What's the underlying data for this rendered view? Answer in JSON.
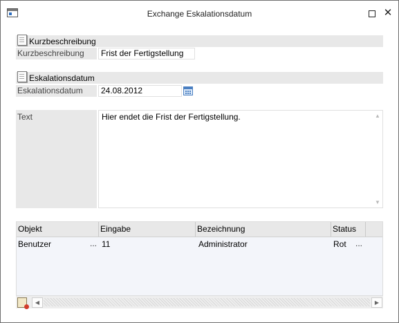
{
  "window": {
    "title": "Exchange Eskalationsdatum",
    "icons": {
      "app": "window-app-icon",
      "maximize": "maximize-icon",
      "close": "close-icon"
    },
    "close_glyph": "✕"
  },
  "sections": {
    "short_desc_header": "Kurzbeschreibung",
    "short_desc_label": "Kurzbeschreibung",
    "short_desc_value": "Frist der Fertigstellung",
    "escalation_header": "Eskalationsdatum",
    "escalation_label": "Eskalationsdatum",
    "escalation_value": "24.08.2012",
    "text_label": "Text",
    "text_value": "Hier endet die Frist der Fertigstellung."
  },
  "grid": {
    "columns": [
      "Objekt",
      "Eingabe",
      "Bezeichnung",
      "Status"
    ],
    "rows": [
      {
        "objekt": "Benutzer",
        "eingabe": "11",
        "bezeichnung": "Administrator",
        "status": "Rot"
      }
    ],
    "ellipsis": "..."
  },
  "colors": {
    "section_bg": "#e8e8e8",
    "grid_bg": "#f3f5fa",
    "accent": "#4a7fc1"
  }
}
